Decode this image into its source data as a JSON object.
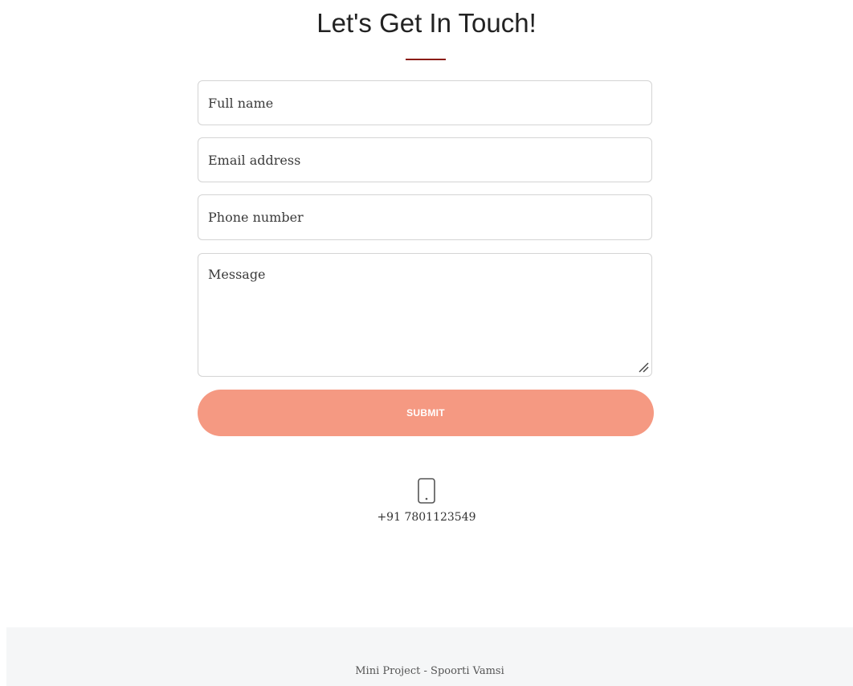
{
  "header": {
    "title": "Let's Get In Touch!",
    "accent_color": "#8b1c14"
  },
  "form": {
    "full_name_placeholder": "Full name",
    "full_name_value": "",
    "email_placeholder": "Email address",
    "email_value": "",
    "phone_placeholder": "Phone number",
    "phone_value": "",
    "message_placeholder": "Message",
    "message_value": "",
    "submit_label": "SUBMIT",
    "submit_color": "#f59982"
  },
  "contact": {
    "icon": "mobile-phone-icon",
    "phone": "+91 7801123549"
  },
  "footer": {
    "text": "Mini Project - Spoorti Vamsi"
  }
}
